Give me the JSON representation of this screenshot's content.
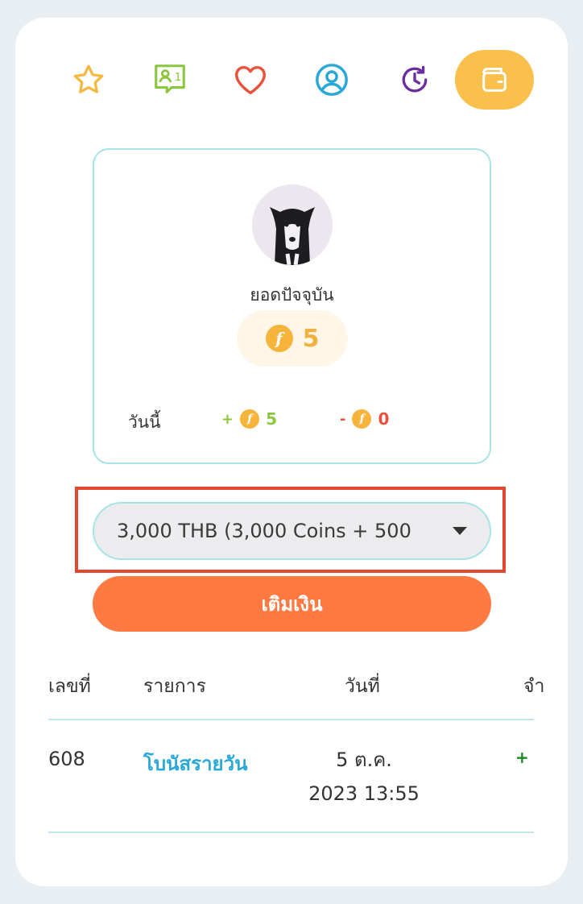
{
  "nav": {
    "items": [
      {
        "name": "favorites",
        "icon": "star-icon",
        "color": "#f5b942"
      },
      {
        "name": "friends",
        "icon": "user-chat-icon",
        "badge": "1",
        "color": "#8cc63f"
      },
      {
        "name": "likes",
        "icon": "heart-icon",
        "color": "#e8523a"
      },
      {
        "name": "profile",
        "icon": "user-circle-icon",
        "color": "#29a9d8"
      },
      {
        "name": "history",
        "icon": "clock-refresh-icon",
        "color": "#6b2ca0"
      },
      {
        "name": "wallet",
        "icon": "wallet-icon",
        "color": "#ffffff",
        "active": true
      }
    ]
  },
  "balance": {
    "label": "ยอดปัจจุบัน",
    "value": "5",
    "today_label": "วันนี้",
    "today_plus_sign": "+",
    "today_plus": "5",
    "today_minus_sign": "-",
    "today_minus": "0",
    "coin_glyph": "f"
  },
  "package": {
    "selected": "3,000 THB (3,000 Coins + 500"
  },
  "topup": {
    "label": "เติมเงิน"
  },
  "table": {
    "headers": [
      "เลขที่",
      "รายการ",
      "วันที่",
      "จำ"
    ],
    "rows": [
      {
        "id": "608",
        "title": "โบนัสรายวัน",
        "date_line1": "5 ต.ค.",
        "date_line2": "2023 13:55",
        "amount": "+"
      }
    ]
  },
  "colors": {
    "accent_orange": "#ff7a43",
    "active_tab": "#fbbf4c",
    "border_teal": "#a8e4e6",
    "highlight_red": "#e0492e"
  }
}
